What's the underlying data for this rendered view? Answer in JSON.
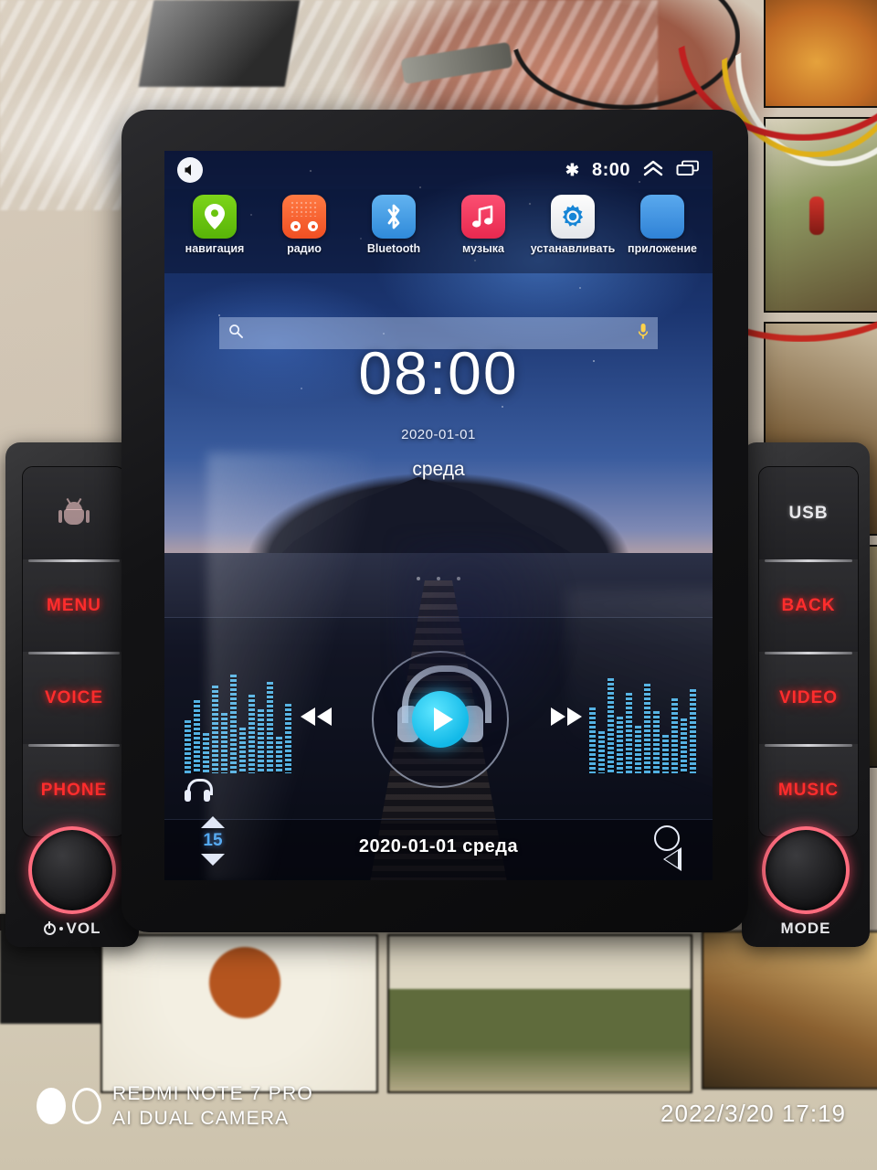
{
  "photo": {
    "watermark": {
      "device": "REDMI NOTE 7 PRO",
      "camera": "AI DUAL CAMERA",
      "timestamp": "2022/3/20 17:19"
    }
  },
  "head_unit": {
    "left_panel": {
      "buttons": [
        {
          "label": "",
          "icon": "android-icon",
          "style": "icon"
        },
        {
          "label": "MENU",
          "style": "red"
        },
        {
          "label": "VOICE",
          "style": "red"
        },
        {
          "label": "PHONE",
          "style": "red"
        }
      ],
      "knob_label": "VOL",
      "knob_icon": "power-icon"
    },
    "right_panel": {
      "buttons": [
        {
          "label": "USB",
          "style": "white"
        },
        {
          "label": "BACK",
          "style": "red"
        },
        {
          "label": "VIDEO",
          "style": "red"
        },
        {
          "label": "MUSIC",
          "style": "red"
        }
      ],
      "knob_label": "MODE"
    },
    "accent_red": "#ff2d2d",
    "knob_ring": "#ff6c7e"
  },
  "screen": {
    "status_bar": {
      "mute_icon": "speaker-mute-icon",
      "bluetooth_icon": "bluetooth-icon",
      "bluetooth_glyph": "✱",
      "time": "8:00",
      "expand_icon": "chevron-double-up-icon",
      "recents_icon": "recent-apps-icon"
    },
    "app_row": [
      {
        "label": "навигация",
        "icon": "navigation-icon"
      },
      {
        "label": "радио",
        "icon": "radio-icon"
      },
      {
        "label": "Bluetooth",
        "icon": "bluetooth-app-icon"
      },
      {
        "label": "музыка",
        "icon": "music-icon"
      },
      {
        "label": "устанавливать",
        "icon": "settings-gear-icon"
      },
      {
        "label": "приложение",
        "icon": "app-drawer-icon"
      }
    ],
    "search": {
      "placeholder": "",
      "value": "",
      "search_icon": "search-icon",
      "mic_icon": "microphone-icon"
    },
    "clock_widget": {
      "time": "08:00",
      "date": "2020-01-01",
      "weekday": "среда"
    },
    "media_player": {
      "prev_icon": "skip-previous-icon",
      "prev_glyph": "⏮",
      "play_icon": "play-icon",
      "next_icon": "skip-next-icon",
      "next_glyph": "⏭",
      "headphones_icon": "headphones-icon"
    },
    "nav_bar": {
      "volume_up_icon": "volume-up-icon",
      "volume_value": "15",
      "volume_down_icon": "volume-down-icon",
      "datetime": "2020-01-01  среда",
      "home_icon": "home-circle-icon",
      "back_icon": "back-triangle-icon"
    }
  }
}
